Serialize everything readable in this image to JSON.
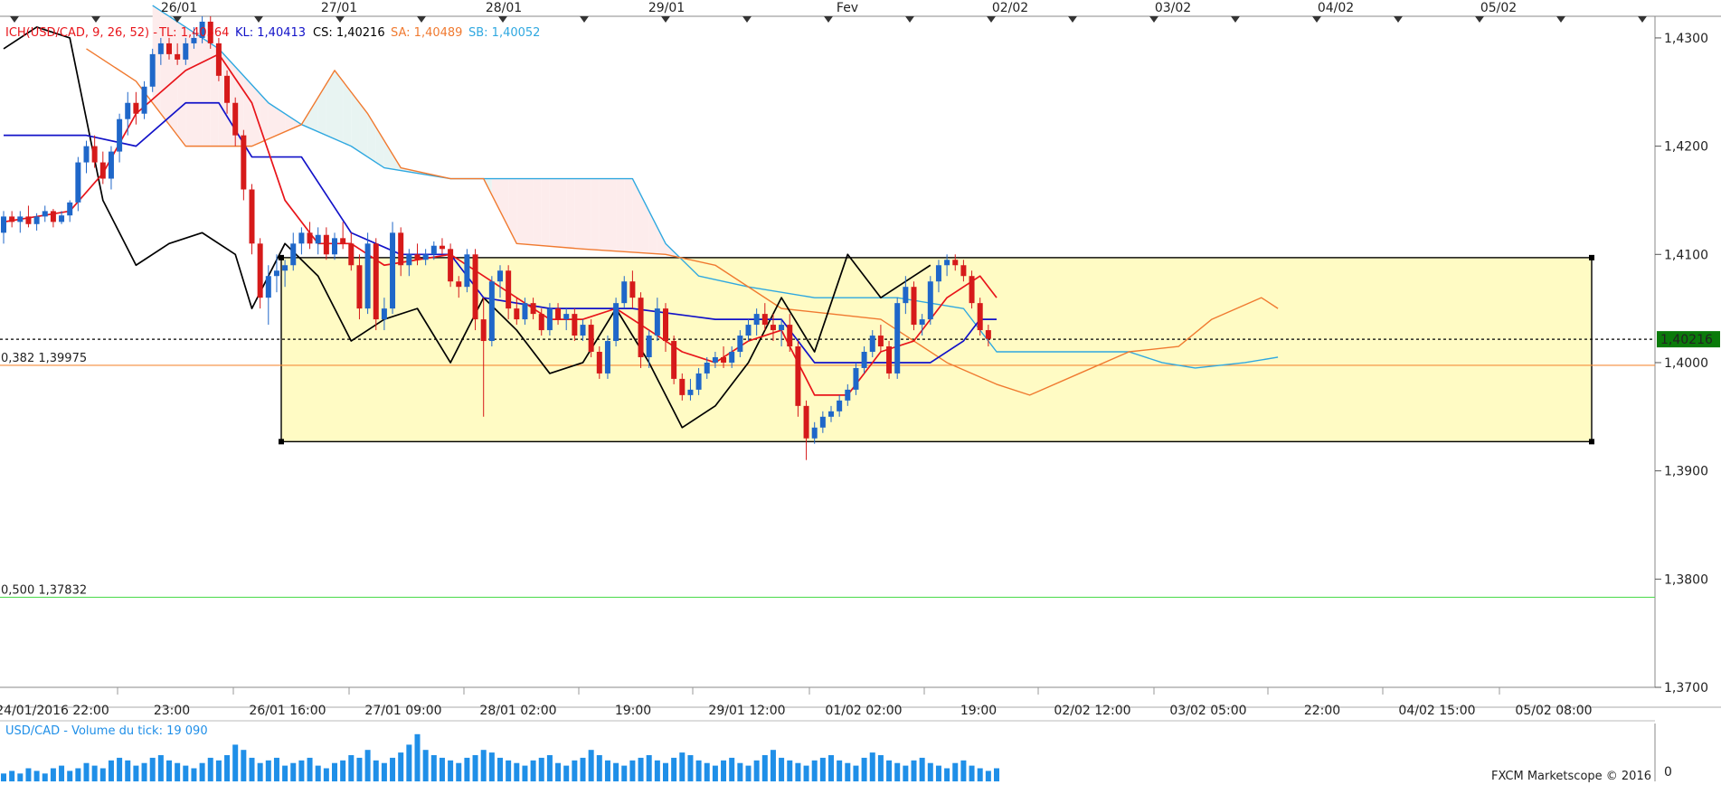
{
  "colors": {
    "background": "#ffffff",
    "grid": "#ececec",
    "bull": "#1f67c9",
    "bear": "#d61a1a",
    "tenkan": "#e8141a",
    "kijun": "#1212c8",
    "chikou": "#000000",
    "senkou_a": "#f07a30",
    "senkou_b": "#2fa8e0",
    "kumo_bear": "#fdecec",
    "kumo_bull": "#e8f4f2",
    "box_fill": "#fffbc4",
    "fib382": "#f58c3a",
    "fib500": "#58dd58",
    "volume": "#1f8fe8",
    "price_badge": "#0a7a0a"
  },
  "chart_data": {
    "type": "candlestick",
    "instrument": "USD/CAD",
    "legend": {
      "ich": "ICH(USD/CAD, 9, 26, 52) -",
      "tl_label": "TL: 1,40564",
      "kl_label": "KL: 1,40413",
      "cs_label": "CS: 1,40216",
      "sa_label": "SA: 1,40489",
      "sb_label": "SB: 1,40052"
    },
    "last_price": "1,40216",
    "ylim": [
      1.37,
      1.432
    ],
    "y_ticks": [
      {
        "value": 1.43,
        "label": "1,4300"
      },
      {
        "value": 1.42,
        "label": "1,4200"
      },
      {
        "value": 1.41,
        "label": "1,4100"
      },
      {
        "value": 1.4,
        "label": "1,4000"
      },
      {
        "value": 1.39,
        "label": "1,3900"
      },
      {
        "value": 1.38,
        "label": "1,3800"
      },
      {
        "value": 1.37,
        "label": "1,3700"
      }
    ],
    "top_date_labels": [
      "26/01",
      "27/01",
      "28/01",
      "29/01",
      "Fev",
      "02/02",
      "03/02",
      "04/02",
      "05/02"
    ],
    "bottom_time_labels": [
      "24/01/2016 22:00",
      "23:00",
      "26/01 16:00",
      "27/01 09:00",
      "28/01 02:00",
      "19:00",
      "29/01 12:00",
      "01/02 02:00",
      "19:00",
      "02/02 12:00",
      "03/02 05:00",
      "22:00",
      "04/02 15:00",
      "05/02 08:00"
    ],
    "fib_levels": [
      {
        "ratio": "0,382",
        "value": 1.39975,
        "label": "0,382 1,39975"
      },
      {
        "ratio": "0,500",
        "value": 1.37832,
        "label": "0,500 1,37832"
      }
    ],
    "range_box": {
      "high": 1.4097,
      "low": 1.3927
    },
    "candles": [
      [
        1.412,
        1.414,
        1.411,
        1.4135
      ],
      [
        1.4135,
        1.414,
        1.4125,
        1.413
      ],
      [
        1.413,
        1.414,
        1.412,
        1.4135
      ],
      [
        1.4135,
        1.4145,
        1.4125,
        1.4128
      ],
      [
        1.4128,
        1.4138,
        1.4122,
        1.4135
      ],
      [
        1.4135,
        1.4145,
        1.413,
        1.414
      ],
      [
        1.414,
        1.4142,
        1.4125,
        1.413
      ],
      [
        1.413,
        1.414,
        1.4128,
        1.4136
      ],
      [
        1.4136,
        1.415,
        1.413,
        1.4148
      ],
      [
        1.4148,
        1.419,
        1.414,
        1.4185
      ],
      [
        1.4185,
        1.4205,
        1.4175,
        1.42
      ],
      [
        1.42,
        1.421,
        1.418,
        1.4185
      ],
      [
        1.4185,
        1.4195,
        1.4165,
        1.417
      ],
      [
        1.417,
        1.42,
        1.416,
        1.4195
      ],
      [
        1.4195,
        1.423,
        1.4185,
        1.4225
      ],
      [
        1.4225,
        1.425,
        1.421,
        1.424
      ],
      [
        1.424,
        1.425,
        1.422,
        1.423
      ],
      [
        1.423,
        1.426,
        1.4225,
        1.4255
      ],
      [
        1.4255,
        1.429,
        1.425,
        1.4285
      ],
      [
        1.4285,
        1.43,
        1.4275,
        1.4295
      ],
      [
        1.4295,
        1.43,
        1.428,
        1.4285
      ],
      [
        1.4285,
        1.4295,
        1.4275,
        1.428
      ],
      [
        1.428,
        1.43,
        1.4275,
        1.4295
      ],
      [
        1.4295,
        1.431,
        1.429,
        1.43
      ],
      [
        1.43,
        1.432,
        1.4295,
        1.4315
      ],
      [
        1.4315,
        1.432,
        1.429,
        1.4295
      ],
      [
        1.4295,
        1.43,
        1.426,
        1.4265
      ],
      [
        1.4265,
        1.427,
        1.423,
        1.424
      ],
      [
        1.424,
        1.4245,
        1.42,
        1.421
      ],
      [
        1.421,
        1.4215,
        1.415,
        1.416
      ],
      [
        1.416,
        1.4165,
        1.41,
        1.411
      ],
      [
        1.411,
        1.4115,
        1.405,
        1.406
      ],
      [
        1.406,
        1.409,
        1.4035,
        1.408
      ],
      [
        1.408,
        1.41,
        1.4065,
        1.4085
      ],
      [
        1.4085,
        1.4095,
        1.407,
        1.409
      ],
      [
        1.409,
        1.412,
        1.4085,
        1.411
      ],
      [
        1.411,
        1.4125,
        1.41,
        1.412
      ],
      [
        1.412,
        1.413,
        1.4105,
        1.411
      ],
      [
        1.411,
        1.4125,
        1.41,
        1.4118
      ],
      [
        1.4118,
        1.4125,
        1.4095,
        1.41
      ],
      [
        1.41,
        1.412,
        1.4095,
        1.4115
      ],
      [
        1.4115,
        1.413,
        1.4105,
        1.411
      ],
      [
        1.411,
        1.412,
        1.4085,
        1.409
      ],
      [
        1.409,
        1.41,
        1.404,
        1.405
      ],
      [
        1.405,
        1.412,
        1.4045,
        1.411
      ],
      [
        1.411,
        1.4115,
        1.403,
        1.404
      ],
      [
        1.404,
        1.406,
        1.403,
        1.405
      ],
      [
        1.405,
        1.413,
        1.4045,
        1.412
      ],
      [
        1.412,
        1.4125,
        1.408,
        1.409
      ],
      [
        1.409,
        1.4105,
        1.408,
        1.41
      ],
      [
        1.41,
        1.411,
        1.409,
        1.4095
      ],
      [
        1.4095,
        1.4105,
        1.409,
        1.41
      ],
      [
        1.41,
        1.4112,
        1.4095,
        1.4108
      ],
      [
        1.4108,
        1.4115,
        1.41,
        1.4105
      ],
      [
        1.4105,
        1.411,
        1.407,
        1.4075
      ],
      [
        1.4075,
        1.408,
        1.406,
        1.407
      ],
      [
        1.407,
        1.4105,
        1.4065,
        1.41
      ],
      [
        1.41,
        1.4105,
        1.403,
        1.404
      ],
      [
        1.404,
        1.406,
        1.395,
        1.402
      ],
      [
        1.402,
        1.408,
        1.4015,
        1.4075
      ],
      [
        1.4075,
        1.409,
        1.406,
        1.4085
      ],
      [
        1.4085,
        1.409,
        1.404,
        1.405
      ],
      [
        1.405,
        1.406,
        1.4035,
        1.404
      ],
      [
        1.404,
        1.406,
        1.4035,
        1.4055
      ],
      [
        1.4055,
        1.406,
        1.404,
        1.4045
      ],
      [
        1.4045,
        1.405,
        1.4025,
        1.403
      ],
      [
        1.403,
        1.4055,
        1.4025,
        1.405
      ],
      [
        1.405,
        1.4055,
        1.4035,
        1.404
      ],
      [
        1.404,
        1.405,
        1.403,
        1.4045
      ],
      [
        1.4045,
        1.405,
        1.402,
        1.4025
      ],
      [
        1.4025,
        1.404,
        1.402,
        1.4035
      ],
      [
        1.4035,
        1.404,
        1.4005,
        1.401
      ],
      [
        1.401,
        1.4015,
        1.3985,
        1.399
      ],
      [
        1.399,
        1.4025,
        1.3985,
        1.402
      ],
      [
        1.402,
        1.406,
        1.4015,
        1.4055
      ],
      [
        1.4055,
        1.408,
        1.405,
        1.4075
      ],
      [
        1.4075,
        1.4085,
        1.405,
        1.406
      ],
      [
        1.406,
        1.4065,
        1.3995,
        1.4005
      ],
      [
        1.4005,
        1.403,
        1.3995,
        1.4025
      ],
      [
        1.4025,
        1.406,
        1.402,
        1.405
      ],
      [
        1.405,
        1.4055,
        1.401,
        1.402
      ],
      [
        1.402,
        1.4025,
        1.398,
        1.3985
      ],
      [
        1.3985,
        1.399,
        1.3965,
        1.397
      ],
      [
        1.397,
        1.3985,
        1.3965,
        1.3975
      ],
      [
        1.3975,
        1.3995,
        1.397,
        1.399
      ],
      [
        1.399,
        1.4005,
        1.3985,
        1.4
      ],
      [
        1.4,
        1.401,
        1.3995,
        1.4005
      ],
      [
        1.4005,
        1.4015,
        1.3995,
        1.4
      ],
      [
        1.4,
        1.4015,
        1.3995,
        1.401
      ],
      [
        1.401,
        1.403,
        1.4005,
        1.4025
      ],
      [
        1.4025,
        1.404,
        1.402,
        1.4035
      ],
      [
        1.4035,
        1.405,
        1.4025,
        1.4045
      ],
      [
        1.4045,
        1.4055,
        1.403,
        1.4035
      ],
      [
        1.4035,
        1.4045,
        1.402,
        1.403
      ],
      [
        1.403,
        1.404,
        1.4015,
        1.4035
      ],
      [
        1.4035,
        1.4045,
        1.401,
        1.4015
      ],
      [
        1.4015,
        1.402,
        1.395,
        1.396
      ],
      [
        1.396,
        1.3965,
        1.391,
        1.393
      ],
      [
        1.393,
        1.3945,
        1.3925,
        1.394
      ],
      [
        1.394,
        1.3955,
        1.3935,
        1.395
      ],
      [
        1.395,
        1.396,
        1.3945,
        1.3955
      ],
      [
        1.3955,
        1.397,
        1.395,
        1.3965
      ],
      [
        1.3965,
        1.398,
        1.396,
        1.3975
      ],
      [
        1.3975,
        1.4,
        1.397,
        1.3995
      ],
      [
        1.3995,
        1.4015,
        1.399,
        1.401
      ],
      [
        1.401,
        1.403,
        1.4005,
        1.4025
      ],
      [
        1.4025,
        1.4035,
        1.401,
        1.4015
      ],
      [
        1.4015,
        1.402,
        1.3985,
        1.399
      ],
      [
        1.399,
        1.406,
        1.3985,
        1.4055
      ],
      [
        1.4055,
        1.408,
        1.4045,
        1.407
      ],
      [
        1.407,
        1.4075,
        1.403,
        1.4035
      ],
      [
        1.4035,
        1.4045,
        1.4025,
        1.404
      ],
      [
        1.404,
        1.408,
        1.4035,
        1.4075
      ],
      [
        1.4075,
        1.4095,
        1.4065,
        1.409
      ],
      [
        1.409,
        1.41,
        1.408,
        1.4095
      ],
      [
        1.4095,
        1.41,
        1.4085,
        1.409
      ],
      [
        1.409,
        1.4095,
        1.4075,
        1.408
      ],
      [
        1.408,
        1.4085,
        1.405,
        1.4055
      ],
      [
        1.4055,
        1.406,
        1.4025,
        1.403
      ],
      [
        1.403,
        1.4035,
        1.4015,
        1.4022
      ]
    ],
    "tenkan": [
      [
        1.413,
        0
      ],
      [
        1.4135,
        4
      ],
      [
        1.414,
        8
      ],
      [
        1.4175,
        12
      ],
      [
        1.423,
        16
      ],
      [
        1.427,
        22
      ],
      [
        1.4285,
        26
      ],
      [
        1.424,
        30
      ],
      [
        1.415,
        34
      ],
      [
        1.411,
        38
      ],
      [
        1.411,
        42
      ],
      [
        1.409,
        46
      ],
      [
        1.4095,
        50
      ],
      [
        1.41,
        54
      ],
      [
        1.408,
        58
      ],
      [
        1.406,
        62
      ],
      [
        1.404,
        66
      ],
      [
        1.404,
        70
      ],
      [
        1.405,
        74
      ],
      [
        1.403,
        78
      ],
      [
        1.401,
        82
      ],
      [
        1.4,
        86
      ],
      [
        1.402,
        90
      ],
      [
        1.403,
        94
      ],
      [
        1.397,
        98
      ],
      [
        1.397,
        102
      ],
      [
        1.401,
        106
      ],
      [
        1.402,
        110
      ],
      [
        1.406,
        114
      ],
      [
        1.408,
        118
      ],
      [
        1.406,
        120
      ]
    ],
    "kijun": [
      [
        1.421,
        0
      ],
      [
        1.421,
        10
      ],
      [
        1.42,
        16
      ],
      [
        1.424,
        22
      ],
      [
        1.424,
        26
      ],
      [
        1.419,
        30
      ],
      [
        1.419,
        36
      ],
      [
        1.412,
        42
      ],
      [
        1.41,
        48
      ],
      [
        1.41,
        54
      ],
      [
        1.406,
        58
      ],
      [
        1.405,
        66
      ],
      [
        1.405,
        76
      ],
      [
        1.404,
        86
      ],
      [
        1.404,
        94
      ],
      [
        1.4,
        98
      ],
      [
        1.4,
        106
      ],
      [
        1.4,
        112
      ],
      [
        1.402,
        116
      ],
      [
        1.404,
        118
      ],
      [
        1.404,
        120
      ]
    ],
    "chikou": [
      [
        1.429,
        0
      ],
      [
        1.431,
        4
      ],
      [
        1.43,
        8
      ],
      [
        1.415,
        12
      ],
      [
        1.409,
        16
      ],
      [
        1.411,
        20
      ],
      [
        1.412,
        24
      ],
      [
        1.41,
        28
      ],
      [
        1.405,
        30
      ],
      [
        1.411,
        34
      ],
      [
        1.408,
        38
      ],
      [
        1.402,
        42
      ],
      [
        1.404,
        46
      ],
      [
        1.405,
        50
      ],
      [
        1.4,
        54
      ],
      [
        1.406,
        58
      ],
      [
        1.403,
        62
      ],
      [
        1.399,
        66
      ],
      [
        1.4,
        70
      ],
      [
        1.405,
        74
      ],
      [
        1.4,
        78
      ],
      [
        1.394,
        82
      ],
      [
        1.396,
        86
      ],
      [
        1.4,
        90
      ],
      [
        1.406,
        94
      ],
      [
        1.401,
        98
      ],
      [
        1.41,
        102
      ],
      [
        1.406,
        106
      ],
      [
        1.408,
        110
      ],
      [
        1.409,
        112
      ]
    ],
    "senkou_a": [
      [
        1.429,
        10
      ],
      [
        1.426,
        16
      ],
      [
        1.42,
        22
      ],
      [
        1.42,
        30
      ],
      [
        1.422,
        36
      ],
      [
        1.427,
        40
      ],
      [
        1.423,
        44
      ],
      [
        1.418,
        48
      ],
      [
        1.417,
        54
      ],
      [
        1.417,
        58
      ],
      [
        1.411,
        62
      ],
      [
        1.4105,
        70
      ],
      [
        1.41,
        80
      ],
      [
        1.409,
        86
      ],
      [
        1.405,
        94
      ],
      [
        1.4045,
        100
      ],
      [
        1.404,
        106
      ],
      [
        1.402,
        110
      ],
      [
        1.4,
        114
      ],
      [
        1.398,
        120
      ],
      [
        1.397,
        124
      ],
      [
        1.399,
        130
      ],
      [
        1.401,
        136
      ],
      [
        1.4015,
        142
      ],
      [
        1.404,
        146
      ],
      [
        1.406,
        152
      ],
      [
        1.405,
        154
      ]
    ],
    "senkou_b": [
      [
        1.433,
        18
      ],
      [
        1.429,
        26
      ],
      [
        1.424,
        32
      ],
      [
        1.422,
        36
      ],
      [
        1.42,
        42
      ],
      [
        1.418,
        46
      ],
      [
        1.417,
        54
      ],
      [
        1.417,
        62
      ],
      [
        1.417,
        76
      ],
      [
        1.411,
        80
      ],
      [
        1.408,
        84
      ],
      [
        1.407,
        90
      ],
      [
        1.406,
        98
      ],
      [
        1.406,
        108
      ],
      [
        1.405,
        116
      ],
      [
        1.401,
        120
      ],
      [
        1.401,
        136
      ],
      [
        1.4,
        140
      ],
      [
        1.3995,
        144
      ],
      [
        1.4,
        150
      ],
      [
        1.4005,
        154
      ]
    ],
    "volume": {
      "label": "USD/CAD - Volume du tick: 19 090",
      "values": [
        3,
        4,
        3,
        5,
        4,
        3,
        5,
        6,
        4,
        5,
        7,
        6,
        5,
        8,
        9,
        8,
        6,
        7,
        9,
        10,
        8,
        7,
        6,
        5,
        7,
        9,
        8,
        10,
        14,
        12,
        9,
        7,
        8,
        9,
        6,
        7,
        8,
        9,
        6,
        5,
        7,
        8,
        10,
        9,
        12,
        8,
        7,
        9,
        11,
        14,
        18,
        12,
        10,
        9,
        8,
        7,
        9,
        10,
        12,
        11,
        9,
        8,
        7,
        6,
        8,
        9,
        10,
        7,
        6,
        8,
        9,
        12,
        10,
        8,
        7,
        6,
        8,
        9,
        10,
        8,
        7,
        9,
        11,
        10,
        8,
        7,
        6,
        8,
        9,
        7,
        6,
        8,
        10,
        12,
        9,
        8,
        7,
        6,
        8,
        9,
        10,
        8,
        7,
        6,
        9,
        11,
        10,
        8,
        7,
        6,
        8,
        9,
        7,
        6,
        5,
        7,
        8,
        6,
        5,
        4,
        5
      ],
      "max": 20
    },
    "footer": "FXCM Marketscope © 2016",
    "volume_axis_label": "0"
  }
}
